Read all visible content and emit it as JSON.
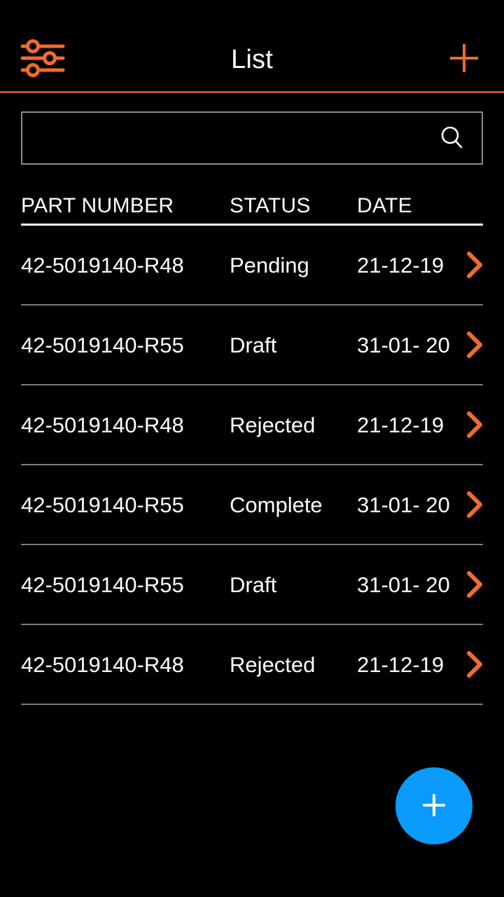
{
  "app": {
    "title": "List",
    "accent_orange": "#F26A2C",
    "divider_orange": "#C0562A",
    "fab_blue": "#0A9BFB",
    "background": "#000000",
    "text_color": "#FFFFFF",
    "row_divider": "#7A7A7A"
  },
  "header": {
    "title": "List",
    "filter_icon": "sliders-filter-icon",
    "add_icon": "plus-icon"
  },
  "search": {
    "value": "",
    "placeholder": "",
    "icon": "search-icon"
  },
  "table": {
    "columns": [
      {
        "key": "part_number",
        "label": "PART NUMBER"
      },
      {
        "key": "status",
        "label": "STATUS"
      },
      {
        "key": "date",
        "label": "DATE"
      }
    ],
    "rows": [
      {
        "part_number": "42-5019140-R48",
        "status": "Pending",
        "date": "21-12-19",
        "arrow": "chevron-right-icon"
      },
      {
        "part_number": "42-5019140-R55",
        "status": "Draft",
        "date": "31-01- 20",
        "arrow": "chevron-right-icon"
      },
      {
        "part_number": "42-5019140-R48",
        "status": "Rejected",
        "date": "21-12-19",
        "arrow": "chevron-right-icon"
      },
      {
        "part_number": "42-5019140-R55",
        "status": "Complete",
        "date": "31-01- 20",
        "arrow": "chevron-right-icon"
      },
      {
        "part_number": "42-5019140-R55",
        "status": "Draft",
        "date": "31-01- 20",
        "arrow": "chevron-right-icon"
      },
      {
        "part_number": "42-5019140-R48",
        "status": "Rejected",
        "date": "21-12-19",
        "arrow": "chevron-right-icon"
      }
    ]
  },
  "fab": {
    "icon": "plus-icon",
    "label": "+"
  }
}
